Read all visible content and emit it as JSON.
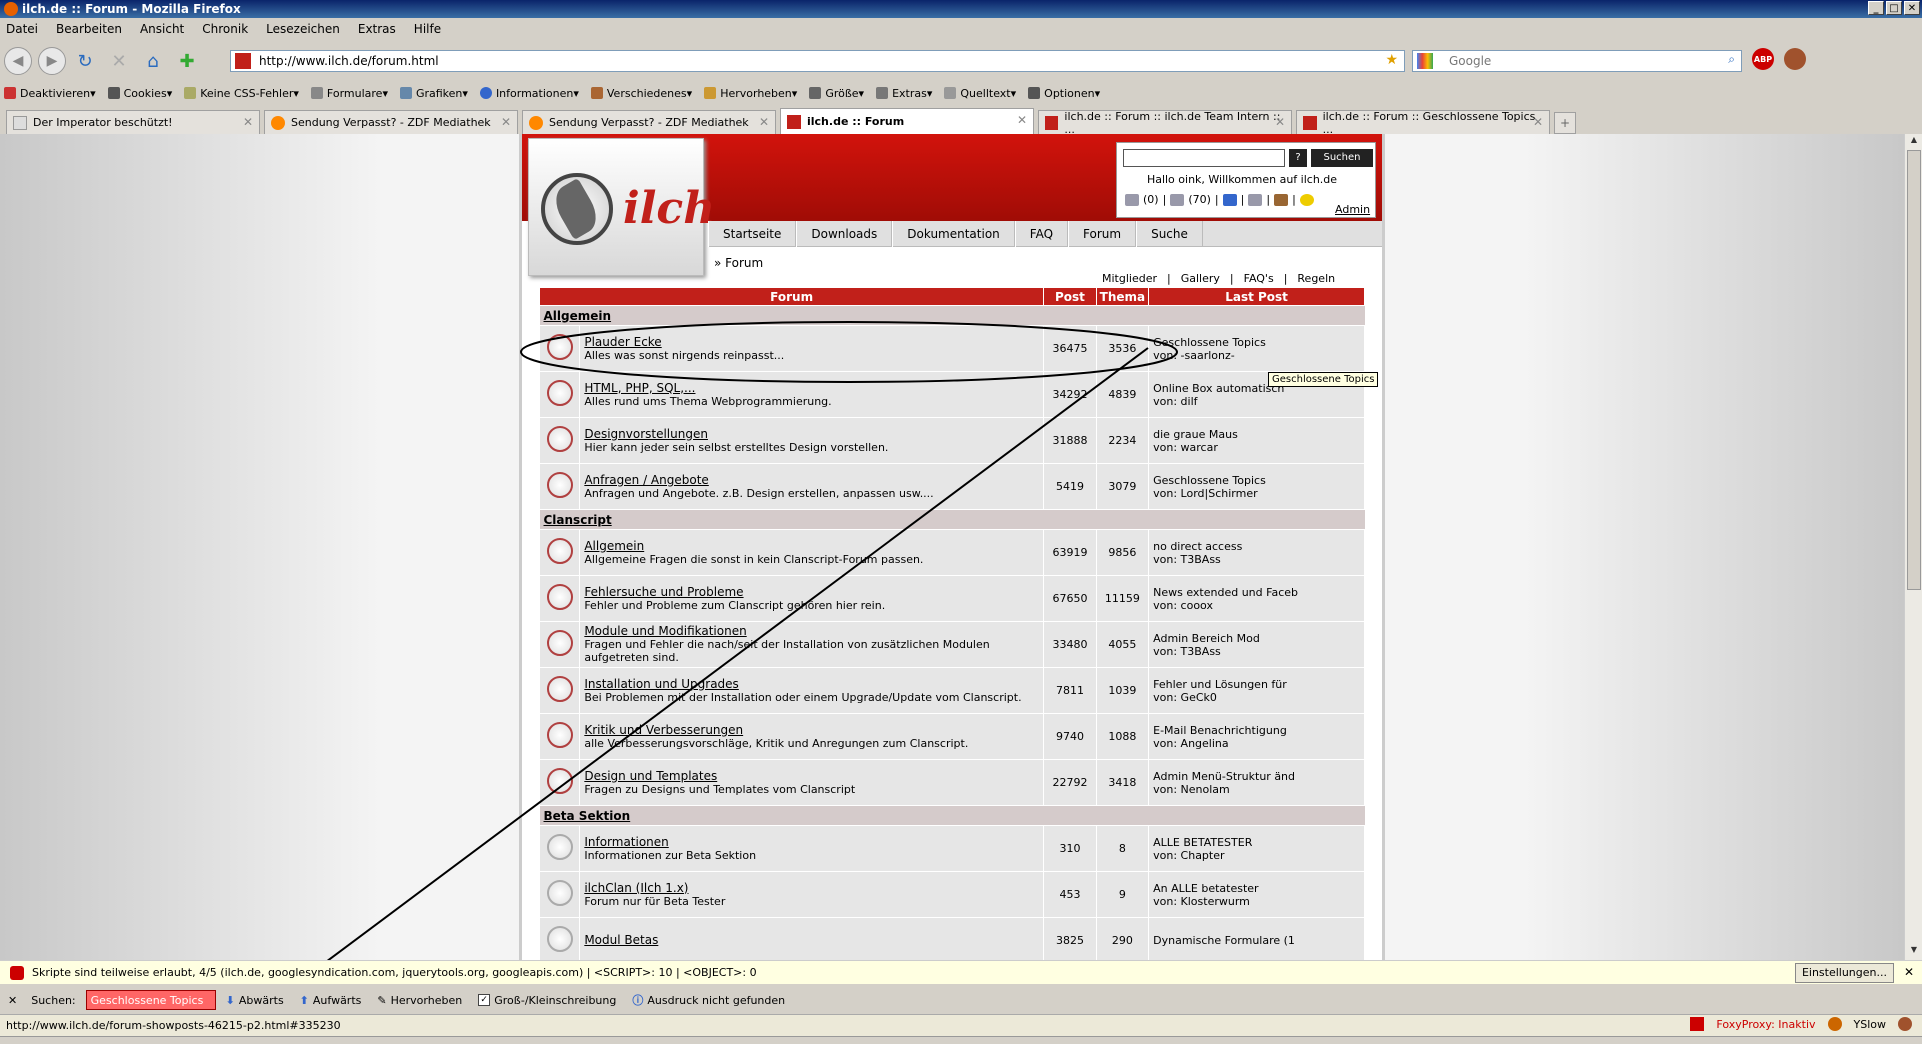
{
  "window": {
    "title": "ilch.de :: Forum - Mozilla Firefox"
  },
  "menu": [
    "Datei",
    "Bearbeiten",
    "Ansicht",
    "Chronik",
    "Lesezeichen",
    "Extras",
    "Hilfe"
  ],
  "url": "http://www.ilch.de/forum.html",
  "search_placeholder": "Google",
  "devbar": [
    "Deaktivieren",
    "Cookies",
    "Keine CSS-Fehler",
    "Formulare",
    "Grafiken",
    "Informationen",
    "Verschiedenes",
    "Hervorheben",
    "Größe",
    "Extras",
    "Quelltext",
    "Optionen"
  ],
  "tabs": [
    {
      "label": "Der Imperator beschützt!",
      "active": false
    },
    {
      "label": "Sendung Verpasst? - ZDF Mediathek",
      "active": false
    },
    {
      "label": "Sendung Verpasst? - ZDF Mediathek",
      "active": false
    },
    {
      "label": "ilch.de :: Forum",
      "active": true
    },
    {
      "label": "ilch.de :: Forum :: ilch.de Team Intern :: ...",
      "active": false
    },
    {
      "label": "ilch.de :: Forum :: Geschlossene Topics ...",
      "active": false
    }
  ],
  "site": {
    "logo_text": "ilch",
    "search_button": "Suchen",
    "help_button": "?",
    "greeting": "Hallo oink, Willkommen auf ilch.de",
    "counters": [
      "(0)",
      "(70)"
    ],
    "admin_link": "Admin",
    "nav": [
      "Startseite",
      "Downloads",
      "Dokumentation",
      "FAQ",
      "Forum",
      "Suche"
    ],
    "breadcrumb": "» Forum",
    "sublinks": [
      "Mitglieder",
      "|",
      "Gallery",
      "|",
      "FAQ's",
      "|",
      "Regeln"
    ]
  },
  "table": {
    "headers": [
      "Forum",
      "Post",
      "Thema",
      "Last Post"
    ],
    "categories": [
      {
        "name": "Allgemein",
        "forums": [
          {
            "name": "Plauder Ecke",
            "desc": "Alles was sonst nirgends reinpasst...",
            "posts": "36475",
            "topics": "3536",
            "last1": "Geschlossene Topics",
            "last2": "von: -saarlonz-"
          },
          {
            "name": "HTML, PHP, SQL,...",
            "desc": "Alles rund ums Thema Webprogrammierung.",
            "posts": "34292",
            "topics": "4839",
            "last1": "Online Box automatisch",
            "last2": "von: dilf"
          },
          {
            "name": "Designvorstellungen",
            "desc": "Hier kann jeder sein selbst erstelltes Design vorstellen.",
            "posts": "31888",
            "topics": "2234",
            "last1": "die graue Maus",
            "last2": "von: warcar"
          },
          {
            "name": "Anfragen / Angebote",
            "desc": "Anfragen und Angebote. z.B. Design erstellen, anpassen usw....",
            "posts": "5419",
            "topics": "3079",
            "last1": "Geschlossene Topics",
            "last2": "von: Lord|Schirmer"
          }
        ]
      },
      {
        "name": "Clanscript",
        "forums": [
          {
            "name": "Allgemein",
            "desc": "Allgemeine Fragen die sonst in kein Clanscript-Forum passen.",
            "posts": "63919",
            "topics": "9856",
            "last1": "no direct access",
            "last2": "von: T3BAss"
          },
          {
            "name": "Fehlersuche und Probleme",
            "desc": "Fehler und Probleme zum Clanscript gehören hier rein.",
            "posts": "67650",
            "topics": "11159",
            "last1": "News extended und Faceb",
            "last2": "von: cooox"
          },
          {
            "name": "Module und Modifikationen",
            "desc": "Fragen und Fehler die nach/seit der Installation von zusätzlichen Modulen aufgetreten sind.",
            "posts": "33480",
            "topics": "4055",
            "last1": "Admin Bereich Mod",
            "last2": "von: T3BAss"
          },
          {
            "name": "Installation und Upgrades",
            "desc": "Bei Problemen mit der Installation oder einem Upgrade/Update vom Clanscript.",
            "posts": "7811",
            "topics": "1039",
            "last1": "Fehler und Lösungen für",
            "last2": "von: GeCk0"
          },
          {
            "name": "Kritik und Verbesserungen",
            "desc": "alle Verbesserungsvorschläge, Kritik und Anregungen zum Clanscript.",
            "posts": "9740",
            "topics": "1088",
            "last1": "E-Mail Benachrichtigung",
            "last2": "von: Angelina"
          },
          {
            "name": "Design und Templates",
            "desc": "Fragen zu Designs und Templates vom Clanscript",
            "posts": "22792",
            "topics": "3418",
            "last1": "Admin Menü-Struktur änd",
            "last2": "von: Nenolam"
          }
        ]
      },
      {
        "name": "Beta Sektion",
        "forums": [
          {
            "name": "Informationen",
            "desc": "Informationen zur Beta Sektion",
            "posts": "310",
            "topics": "8",
            "last1": "ALLE BETATESTER",
            "last2": "von: Chapter"
          },
          {
            "name": "ilchClan (Ilch 1.x)",
            "desc": "Forum nur für Beta Tester",
            "posts": "453",
            "topics": "9",
            "last1": "An ALLE betatester",
            "last2": "von: Klosterwurm"
          },
          {
            "name": "Modul Betas",
            "desc": "",
            "posts": "3825",
            "topics": "290",
            "last1": "Dynamische Formulare (1",
            "last2": ""
          }
        ]
      }
    ]
  },
  "tooltip": "Geschlossene Topics",
  "scriptbar": {
    "text": "Skripte sind teilweise erlaubt, 4/5 (ilch.de, googlesyndication.com, jquerytools.org, googleapis.com) | <SCRIPT>: 10 | <OBJECT>: 0",
    "settings": "Einstellungen..."
  },
  "findbar": {
    "label": "Suchen:",
    "value": "Geschlossene Topics",
    "down": "Abwärts",
    "up": "Aufwärts",
    "highlight": "Hervorheben",
    "case": "Groß-/Kleinschreibung",
    "status": "Ausdruck nicht gefunden"
  },
  "status": {
    "url": "http://www.ilch.de/forum-showposts-46215-p2.html#335230",
    "foxy": "FoxyProxy: Inaktiv",
    "yslow": "YSlow"
  }
}
